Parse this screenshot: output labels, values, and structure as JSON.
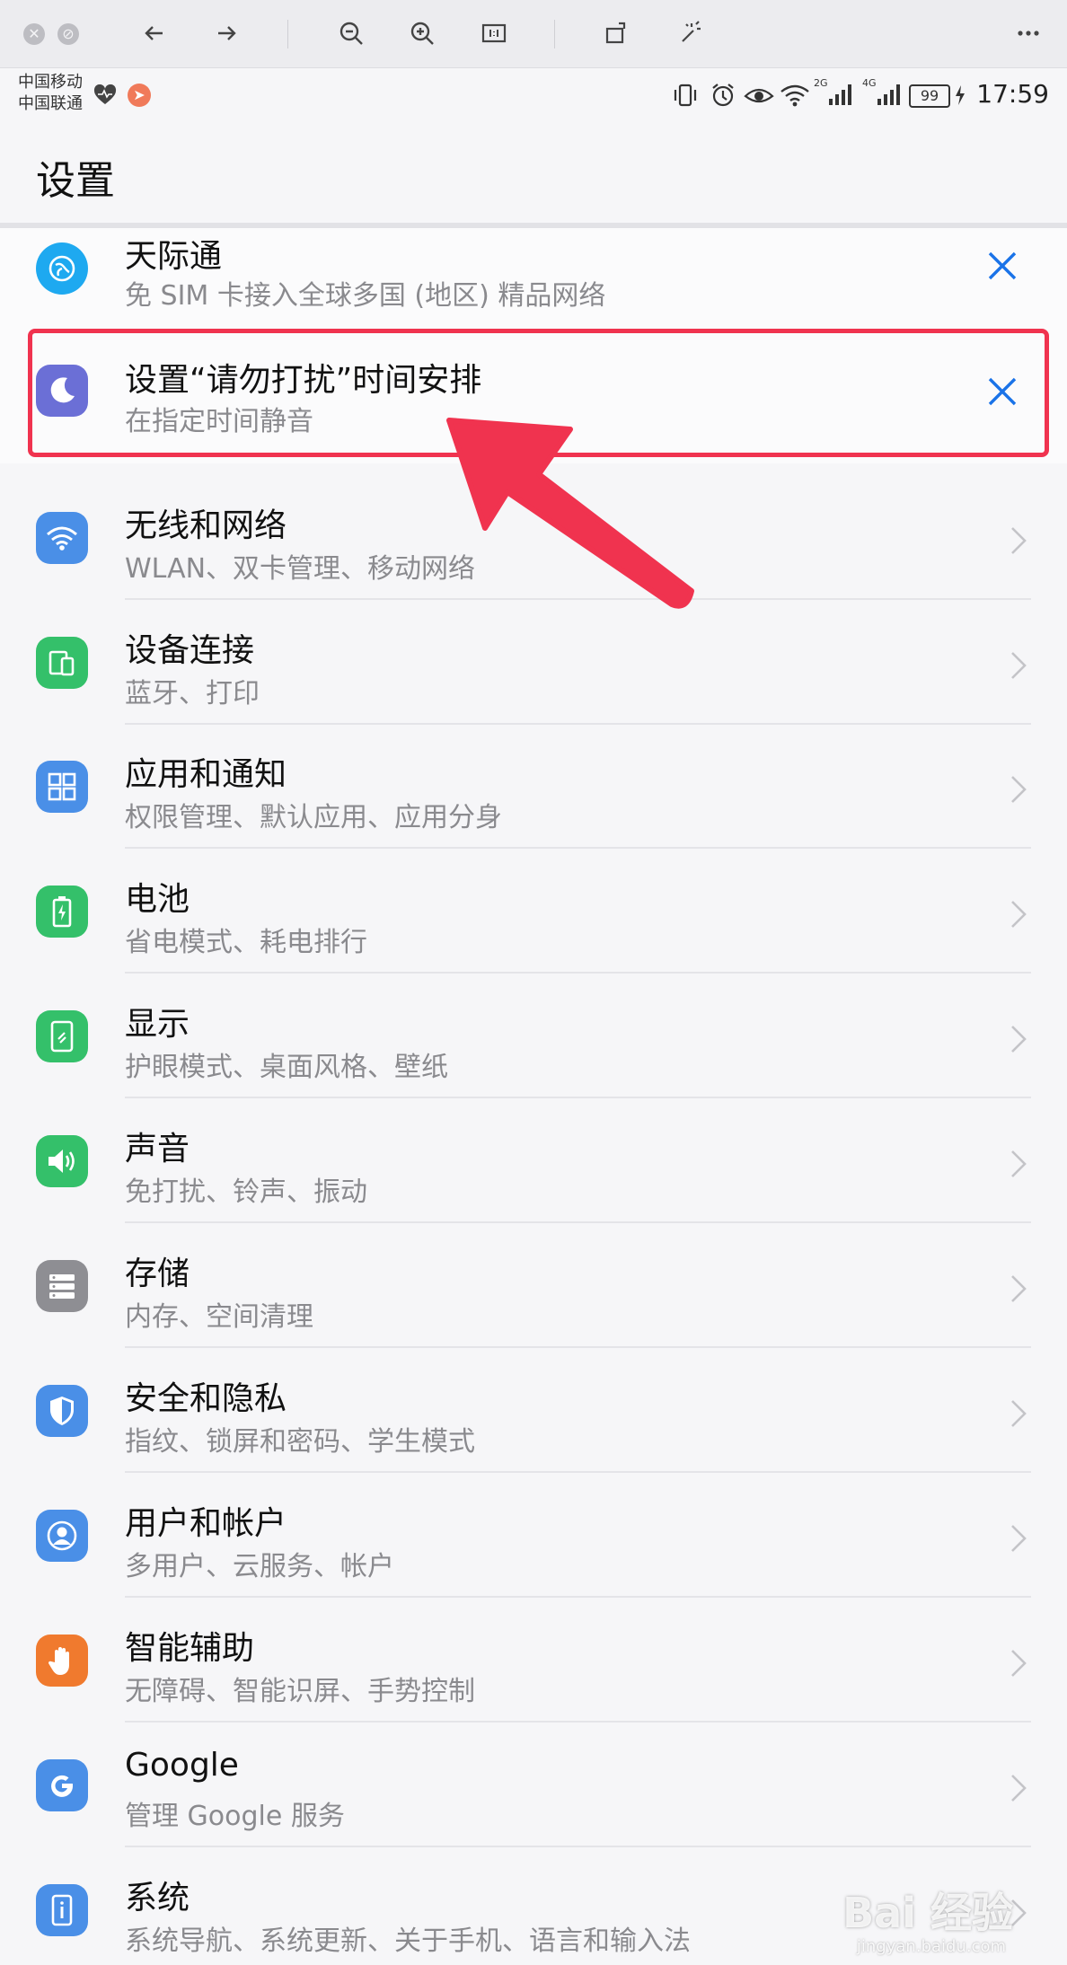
{
  "status_bar": {
    "carrier_1": "中国移动",
    "carrier_2": "中国联通",
    "net_2g": "2G",
    "net_4g": "4G",
    "battery": "99",
    "time": "17:59"
  },
  "header": {
    "title": "设置"
  },
  "suggestions": [
    {
      "title": "天际通",
      "subtitle": "免 SIM 卡接入全球多国 (地区) 精品网络",
      "icon": "globe-icon",
      "color": "#1ea9f0"
    },
    {
      "title": "设置“请勿打扰”时间安排",
      "subtitle": "在指定时间静音",
      "icon": "moon-icon",
      "color": "#6b6fd6"
    }
  ],
  "settings": [
    {
      "title": "无线和网络",
      "subtitle": "WLAN、双卡管理、移动网络",
      "icon": "wifi-icon",
      "color": "#4a8fe7"
    },
    {
      "title": "设备连接",
      "subtitle": "蓝牙、打印",
      "icon": "device-connection-icon",
      "color": "#34c06a"
    },
    {
      "title": "应用和通知",
      "subtitle": "权限管理、默认应用、应用分身",
      "icon": "apps-icon",
      "color": "#4a8fe7"
    },
    {
      "title": "电池",
      "subtitle": "省电模式、耗电排行",
      "icon": "battery-icon",
      "color": "#34c06a"
    },
    {
      "title": "显示",
      "subtitle": "护眼模式、桌面风格、壁纸",
      "icon": "display-icon",
      "color": "#34c06a"
    },
    {
      "title": "声音",
      "subtitle": "免打扰、铃声、振动",
      "icon": "sound-icon",
      "color": "#34c06a"
    },
    {
      "title": "存储",
      "subtitle": "内存、空间清理",
      "icon": "storage-icon",
      "color": "#8e8e93"
    },
    {
      "title": "安全和隐私",
      "subtitle": "指纹、锁屏和密码、学生模式",
      "icon": "shield-icon",
      "color": "#4a8fe7"
    },
    {
      "title": "用户和帐户",
      "subtitle": "多用户、云服务、帐户",
      "icon": "user-icon",
      "color": "#4a8fe7"
    },
    {
      "title": "智能辅助",
      "subtitle": "无障碍、智能识屏、手势控制",
      "icon": "hand-icon",
      "color": "#f07a2e"
    },
    {
      "title": "Google",
      "subtitle": "管理 Google 服务",
      "icon": "google-icon",
      "color": "#4a8fe7"
    },
    {
      "title": "系统",
      "subtitle": "系统导航、系统更新、关于手机、语言和输入法",
      "icon": "system-icon",
      "color": "#4a8fe7"
    }
  ],
  "watermark": {
    "brand": "Bai 经验",
    "url": "jingyan.baidu.com"
  },
  "colors": {
    "accent": "#1a73e8",
    "highlight": "#f0334f"
  }
}
